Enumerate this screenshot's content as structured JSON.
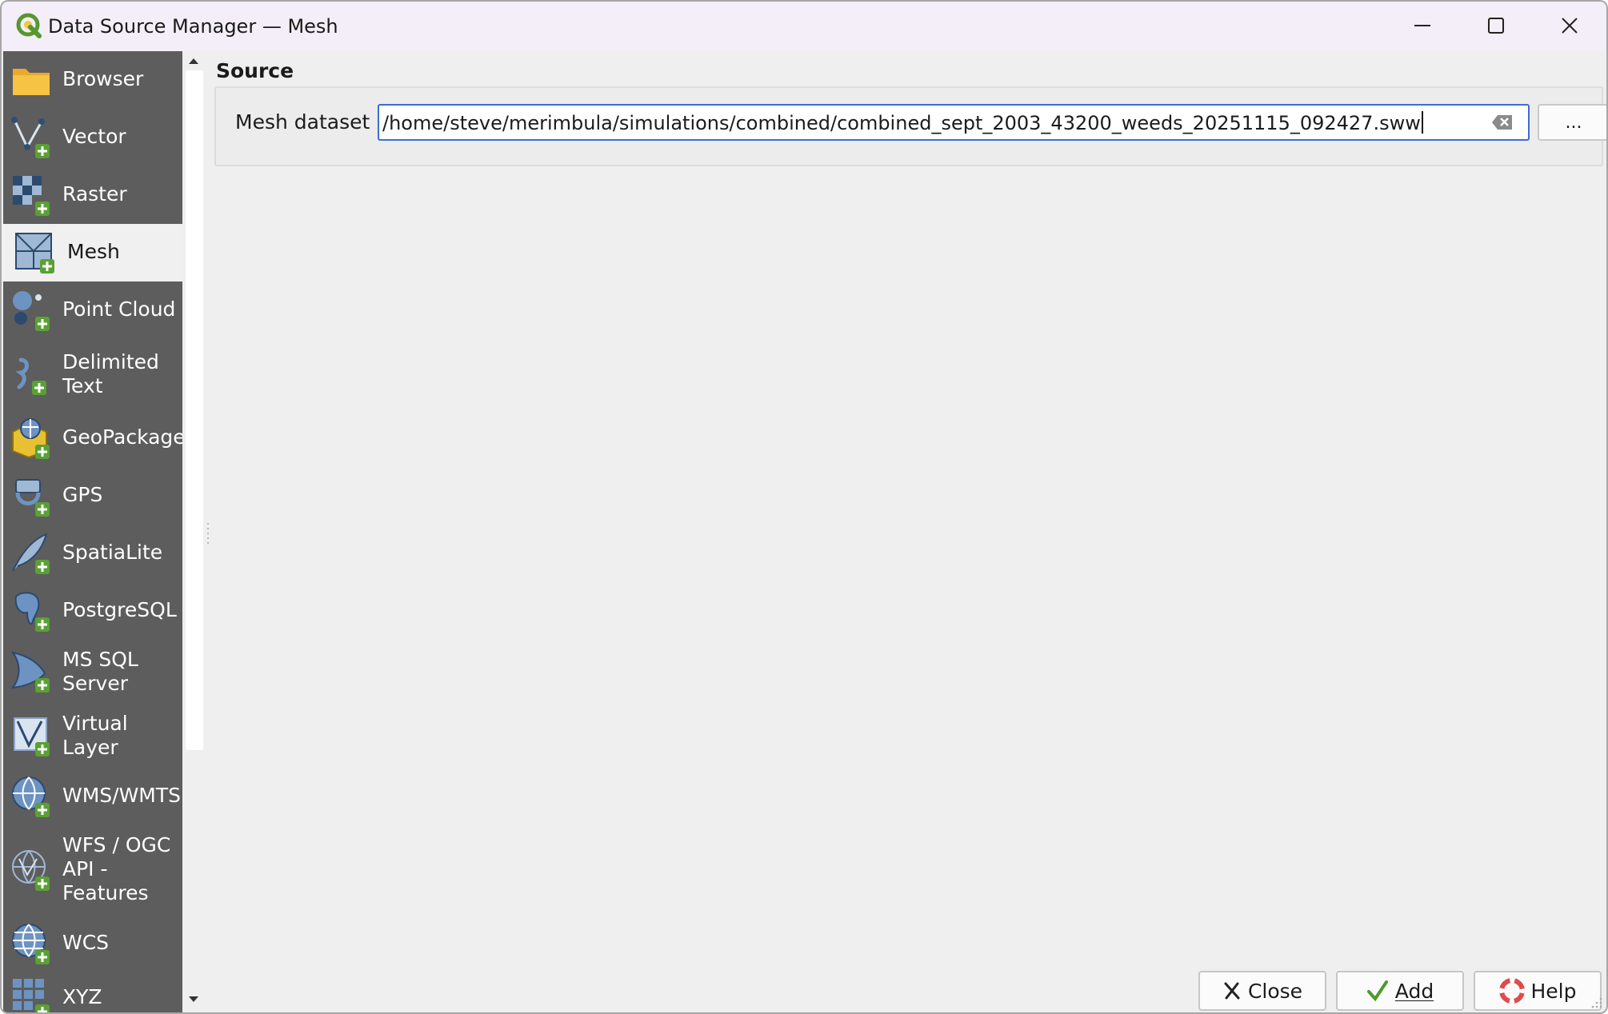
{
  "window": {
    "title": "Data Source Manager — Mesh",
    "controls": [
      "minimize-icon",
      "maximize-icon",
      "close-icon"
    ]
  },
  "sidebar": {
    "items": [
      {
        "label": "Browser",
        "icon": "folder-icon",
        "active": false
      },
      {
        "label": "Vector",
        "icon": "vector-add-icon",
        "active": false
      },
      {
        "label": "Raster",
        "icon": "raster-add-icon",
        "active": false
      },
      {
        "label": "Mesh",
        "icon": "mesh-add-icon",
        "active": true
      },
      {
        "label": "Point Cloud",
        "icon": "point-cloud-add-icon",
        "active": false
      },
      {
        "label": "Delimited\nText",
        "icon": "delimited-text-add-icon",
        "active": false
      },
      {
        "label": "GeoPackage",
        "icon": "geopackage-add-icon",
        "active": false
      },
      {
        "label": "GPS",
        "icon": "gps-add-icon",
        "active": false
      },
      {
        "label": "SpatiaLite",
        "icon": "spatialite-add-icon",
        "active": false
      },
      {
        "label": "PostgreSQL",
        "icon": "postgresql-add-icon",
        "active": false
      },
      {
        "label": "MS SQL\nServer",
        "icon": "mssql-add-icon",
        "active": false
      },
      {
        "label": "Virtual\nLayer",
        "icon": "virtual-layer-add-icon",
        "active": false
      },
      {
        "label": "WMS/WMTS",
        "icon": "wms-add-icon",
        "active": false
      },
      {
        "label": "WFS / OGC\nAPI -\nFeatures",
        "icon": "wfs-add-icon",
        "active": false
      },
      {
        "label": "WCS",
        "icon": "wcs-add-icon",
        "active": false
      },
      {
        "label": "XYZ",
        "icon": "xyz-add-icon",
        "active": false
      }
    ]
  },
  "source": {
    "section_title": "Source",
    "field_label": "Mesh dataset",
    "path_value": "/home/steve/merimbula/simulations/combined/combined_sept_2003_43200_weeds_20251115_092427.sww",
    "browse_label": "..."
  },
  "buttons": {
    "close_label": "Close",
    "add_label": "Add",
    "help_label": "Help"
  },
  "colors": {
    "sidebar_bg": "#5d5d5d",
    "accent": "#3b6fcf",
    "titlebar_bg": "#f3eef7"
  }
}
